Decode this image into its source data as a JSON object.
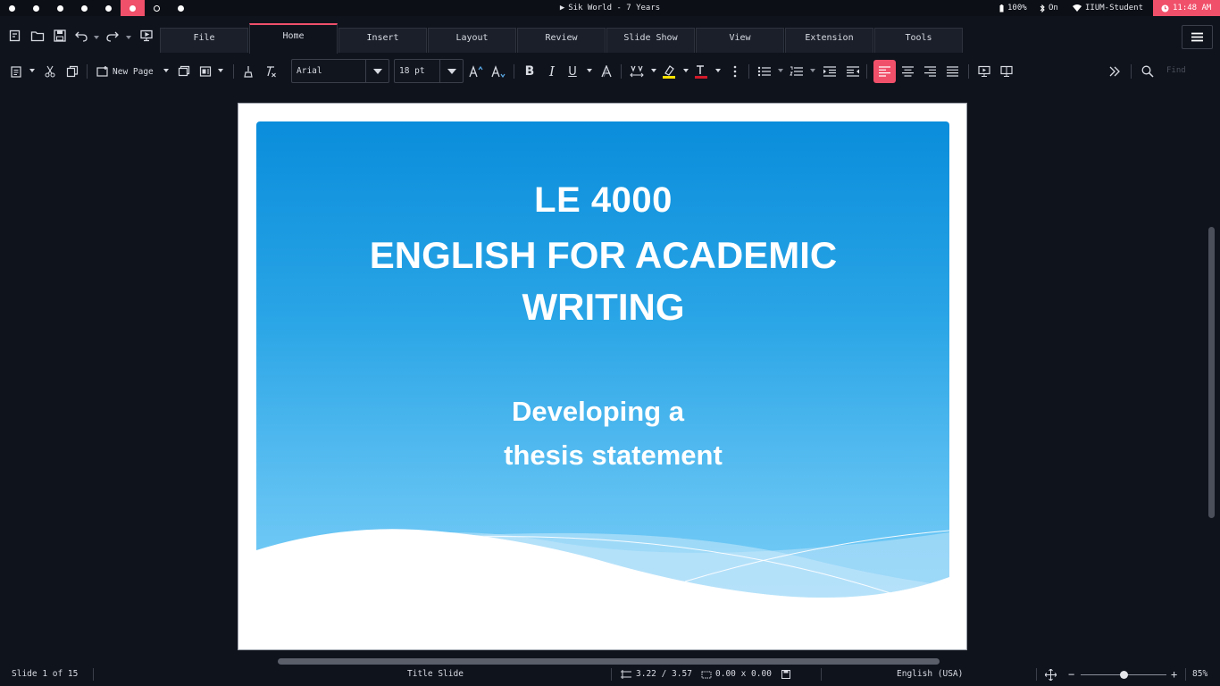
{
  "system_bar": {
    "media_title": "Sik World - 7 Years",
    "battery": "100%",
    "bluetooth": "On",
    "wifi": "IIUM-Student",
    "clock": "11:48 AM",
    "workspaces": [
      "filled",
      "filled",
      "filled",
      "filled",
      "filled",
      "active",
      "empty",
      "filled"
    ]
  },
  "tabs": [
    "File",
    "Home",
    "Insert",
    "Layout",
    "Review",
    "Slide Show",
    "View",
    "Extension",
    "Tools"
  ],
  "active_tab": "Home",
  "toolbar": {
    "new_page_label": "New Page",
    "font_name": "Arial",
    "font_size": "18 pt",
    "find_placeholder": "Find",
    "accent_color": "#f0506a",
    "highlight_color": "#ffe100",
    "font_color": "#d11a2a"
  },
  "slide": {
    "title_line1": "LE 4000",
    "title_line2": "ENGLISH FOR ACADEMIC",
    "title_line3": "WRITING",
    "subtitle_line1": "Developing a",
    "subtitle_line2": "thesis statement"
  },
  "status": {
    "slide_count": "Slide 1 of 15",
    "layout_name": "Title Slide",
    "position": "3.22 / 3.57",
    "size": "0.00 x 0.00",
    "language": "English (USA)",
    "zoom_percent": "85%",
    "zoom_level": 0.5
  }
}
